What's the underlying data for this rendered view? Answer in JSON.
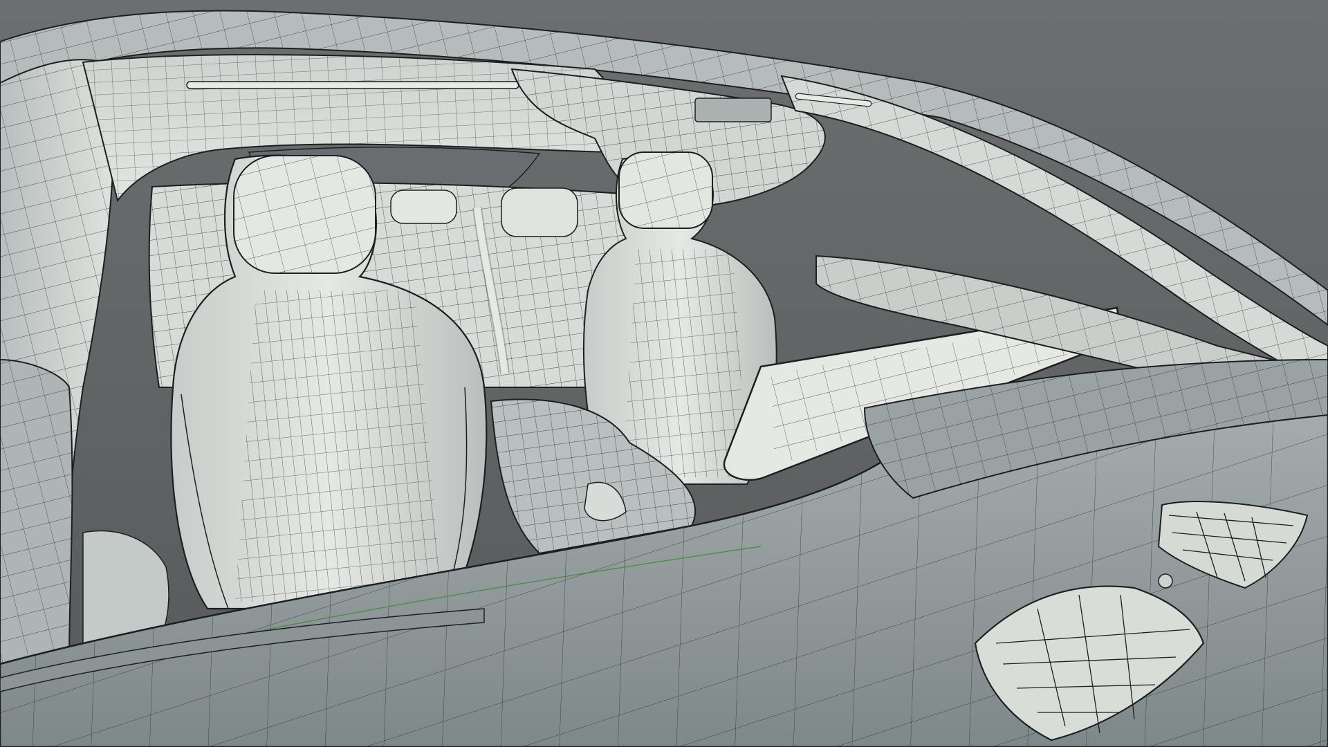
{
  "scene": {
    "subject": "car-interior-wireframe",
    "colors": {
      "background_top": "#6a6c6e",
      "background_bottom": "#55585a",
      "surface_light": "#e4e6e2",
      "surface_mid": "#c9cdca",
      "surface_shadow": "#8f9697",
      "surface_dark": "#6f7679",
      "dash_top": "#9aa2a3",
      "wire": "#1c1f20",
      "wire_light": "#3a3f41",
      "accent_green": "#3f8a3a"
    }
  }
}
